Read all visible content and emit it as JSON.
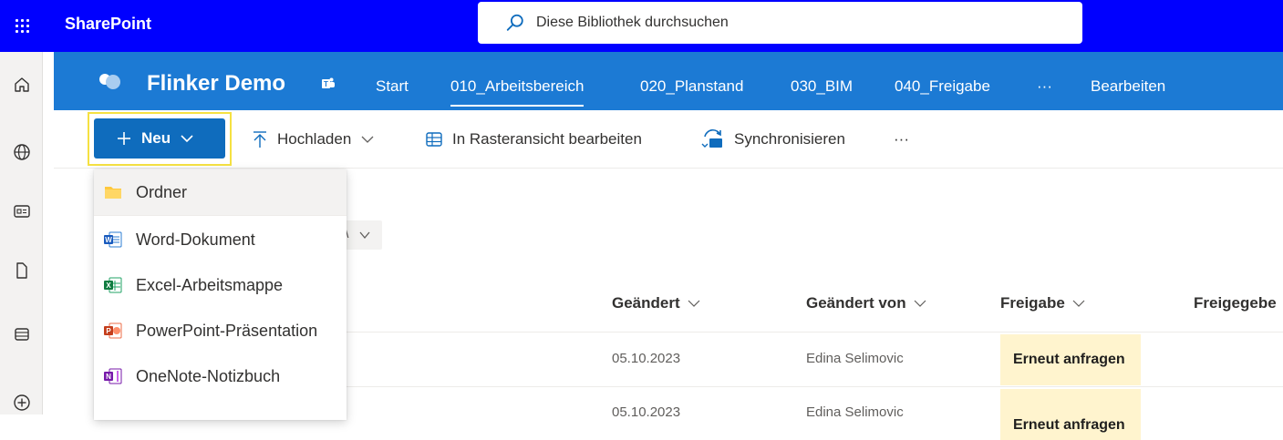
{
  "suite": {
    "app_name": "SharePoint",
    "search_placeholder": "Diese Bibliothek durchsuchen"
  },
  "site": {
    "title": "Flinker Demo",
    "nav": [
      {
        "label": "Start",
        "active": false
      },
      {
        "label": "010_Arbeitsbereich",
        "active": true
      },
      {
        "label": "020_Planstand",
        "active": false
      },
      {
        "label": "030_BIM",
        "active": false
      },
      {
        "label": "040_Freigabe",
        "active": false
      },
      {
        "label": "···",
        "active": false
      },
      {
        "label": "Bearbeiten",
        "active": false
      }
    ]
  },
  "commandbar": {
    "new_label": "Neu",
    "upload_label": "Hochladen",
    "grid_label": "In Rasteransicht bearbeiten",
    "sync_label": "Synchronisieren",
    "more_label": "···"
  },
  "new_menu": {
    "items": [
      {
        "label": "Ordner",
        "icon": "folder-icon"
      },
      {
        "label": "Word-Dokument",
        "icon": "word-icon"
      },
      {
        "label": "Excel-Arbeitsmappe",
        "icon": "excel-icon"
      },
      {
        "label": "PowerPoint-Präsentation",
        "icon": "powerpoint-icon"
      },
      {
        "label": "OneNote-Notizbuch",
        "icon": "onenote-icon"
      }
    ]
  },
  "table": {
    "columns": [
      "Geändert",
      "Geändert von",
      "Freigabe",
      "Freigegebe"
    ],
    "rows": [
      {
        "modified": "05.10.2023",
        "modified_by": "Edina Selimovic",
        "status": "Erneut anfragen"
      },
      {
        "modified": "05.10.2023",
        "modified_by": "Edina Selimovic",
        "status": "Erneut anfragen"
      }
    ]
  },
  "colors": {
    "suite_bar": "#0000ff",
    "site_header": "#1c7ad4",
    "primary_button": "#0f6cbd",
    "highlight_frame": "#f5e142",
    "status_fill": "#fff4ce"
  }
}
